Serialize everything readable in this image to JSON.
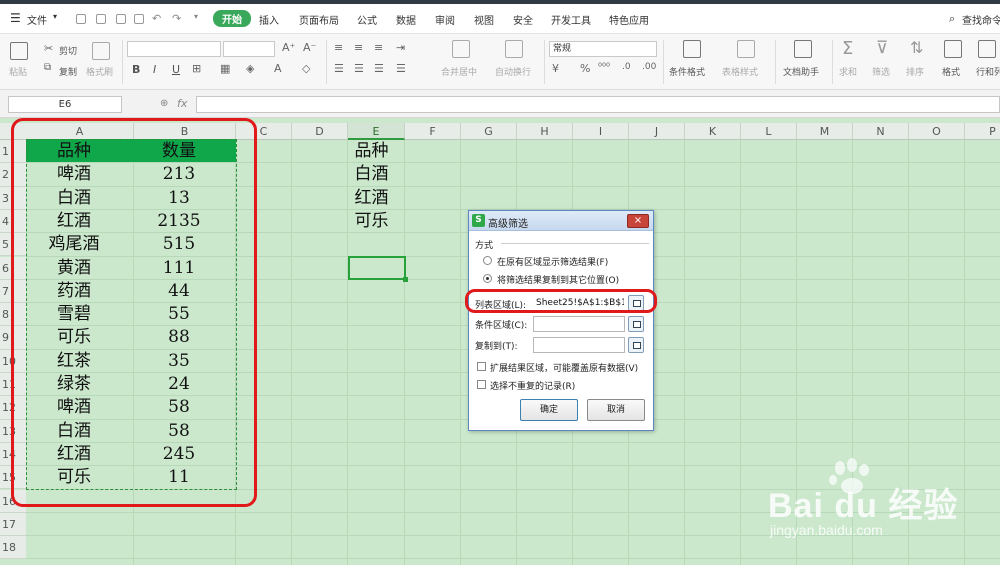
{
  "menubar": {
    "file_label": "文件",
    "tabs": [
      "开始",
      "插入",
      "页面布局",
      "公式",
      "数据",
      "审阅",
      "视图",
      "安全",
      "开发工具",
      "特色应用"
    ],
    "search_label": "查找命令"
  },
  "ribbon": {
    "paste": "粘贴",
    "cut": "剪切",
    "copy": "复制",
    "format_painter": "格式刷",
    "bold": "B",
    "italic": "I",
    "underline": "U",
    "merge_center": "合并居中",
    "wrap_text": "自动换行",
    "number_format": "常规",
    "conditional_format": "条件格式",
    "table_style": "表格样式",
    "doc_assistant": "文档助手",
    "sum": "求和",
    "filter": "筛选",
    "sort": "排序",
    "format": "格式",
    "rows_cols": "行和列"
  },
  "formula_bar": {
    "name_box": "E6",
    "fx": "fx"
  },
  "sheet": {
    "columns": [
      "A",
      "B",
      "C",
      "D",
      "E",
      "F",
      "G",
      "H",
      "I",
      "J",
      "K",
      "L",
      "M",
      "N",
      "O",
      "P"
    ],
    "selected_column": "E",
    "row_numbers": [
      "1",
      "2",
      "3",
      "4",
      "5",
      "6",
      "7",
      "8",
      "9",
      "10",
      "11",
      "12",
      "13",
      "14",
      "15",
      "16",
      "17",
      "18"
    ],
    "header": [
      "品种",
      "数量"
    ],
    "rows": [
      [
        "啤酒",
        "213"
      ],
      [
        "白酒",
        "13"
      ],
      [
        "红酒",
        "2135"
      ],
      [
        "鸡尾酒",
        "515"
      ],
      [
        "黄酒",
        "111"
      ],
      [
        "药酒",
        "44"
      ],
      [
        "雪碧",
        "55"
      ],
      [
        "可乐",
        "88"
      ],
      [
        "红茶",
        "35"
      ],
      [
        "绿茶",
        "24"
      ],
      [
        "啤酒",
        "58"
      ],
      [
        "白酒",
        "58"
      ],
      [
        "红酒",
        "245"
      ],
      [
        "可乐",
        "11"
      ]
    ],
    "criteria_column": [
      "品种",
      "白酒",
      "红酒",
      "可乐"
    ],
    "active_cell": "E6"
  },
  "dialog": {
    "title": "高级筛选",
    "close": "×",
    "section_label": "方式",
    "option_in_place": "在原有区域显示筛选结果(F)",
    "option_copy": "将筛选结果复制到其它位置(O)",
    "list_range_label": "列表区域(L):",
    "list_range_value": "Sheet25!$A$1:$B$1",
    "criteria_range_label": "条件区域(C):",
    "criteria_range_value": "",
    "copy_to_label": "复制到(T):",
    "copy_to_value": "",
    "expand_label": "扩展结果区域，可能覆盖原有数据(V)",
    "unique_label": "选择不重复的记录(R)",
    "ok": "确定",
    "cancel": "取消"
  },
  "watermark": {
    "brand": "Bai du 经验",
    "url": "jingyan.baidu.com"
  },
  "colors": {
    "grid_green": "#cbe8cd",
    "header_fill": "#10a64a",
    "annotation_red": "#e0191b",
    "accent": "#3aa85a"
  }
}
